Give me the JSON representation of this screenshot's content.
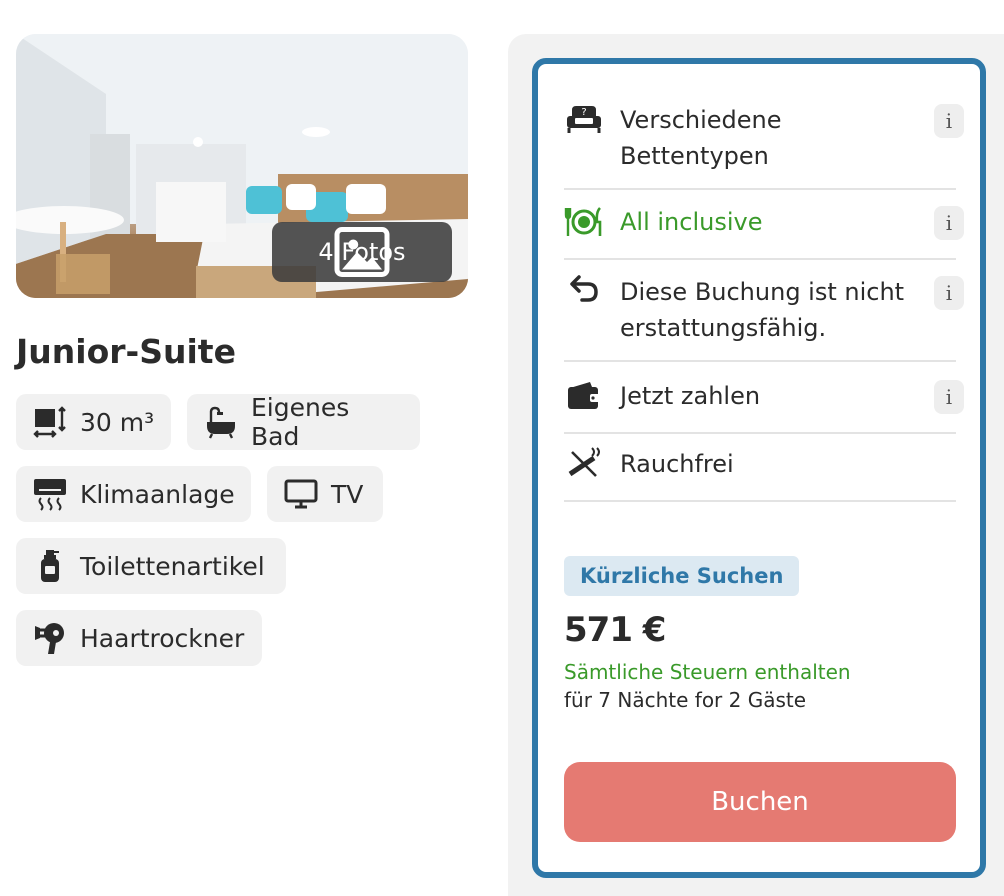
{
  "room": {
    "photo_badge": "4 Fotos",
    "title": "Junior-Suite",
    "amenities": [
      {
        "icon": "room-size-icon",
        "label": "30 m³"
      },
      {
        "icon": "bathtub-icon",
        "label": "Eigenes Bad"
      },
      {
        "icon": "air-conditioning-icon",
        "label": "Klimaanlage"
      },
      {
        "icon": "tv-icon",
        "label": "TV"
      },
      {
        "icon": "toiletries-icon",
        "label": "Toilettenartikel"
      },
      {
        "icon": "hairdryer-icon",
        "label": "Haartrockner"
      }
    ]
  },
  "offer": {
    "features": [
      {
        "icon": "bed-question-icon",
        "text": "Verschiedene Bettentypen",
        "info": "i"
      },
      {
        "icon": "meal-icon",
        "text": "All inclusive",
        "info": "i"
      },
      {
        "icon": "undo-arrow-icon",
        "text": "Diese Buchung ist nicht erstattungsfähig.",
        "info": "i"
      },
      {
        "icon": "wallet-icon",
        "text": "Jetzt zahlen",
        "info": "i"
      },
      {
        "icon": "no-smoking-icon",
        "text": "Rauchfrei"
      }
    ],
    "tag": "Kürzliche Suchen",
    "price": "571 €",
    "tax_note": "Sämtliche Steuern enthalten",
    "stay_note": "für 7 Nächte for 2 Gäste",
    "book_label": "Buchen"
  },
  "colors": {
    "card_border": "#2f78a8",
    "green": "#3a9a2a",
    "book_button": "#e57a72",
    "tag_bg": "#dce9f2"
  }
}
